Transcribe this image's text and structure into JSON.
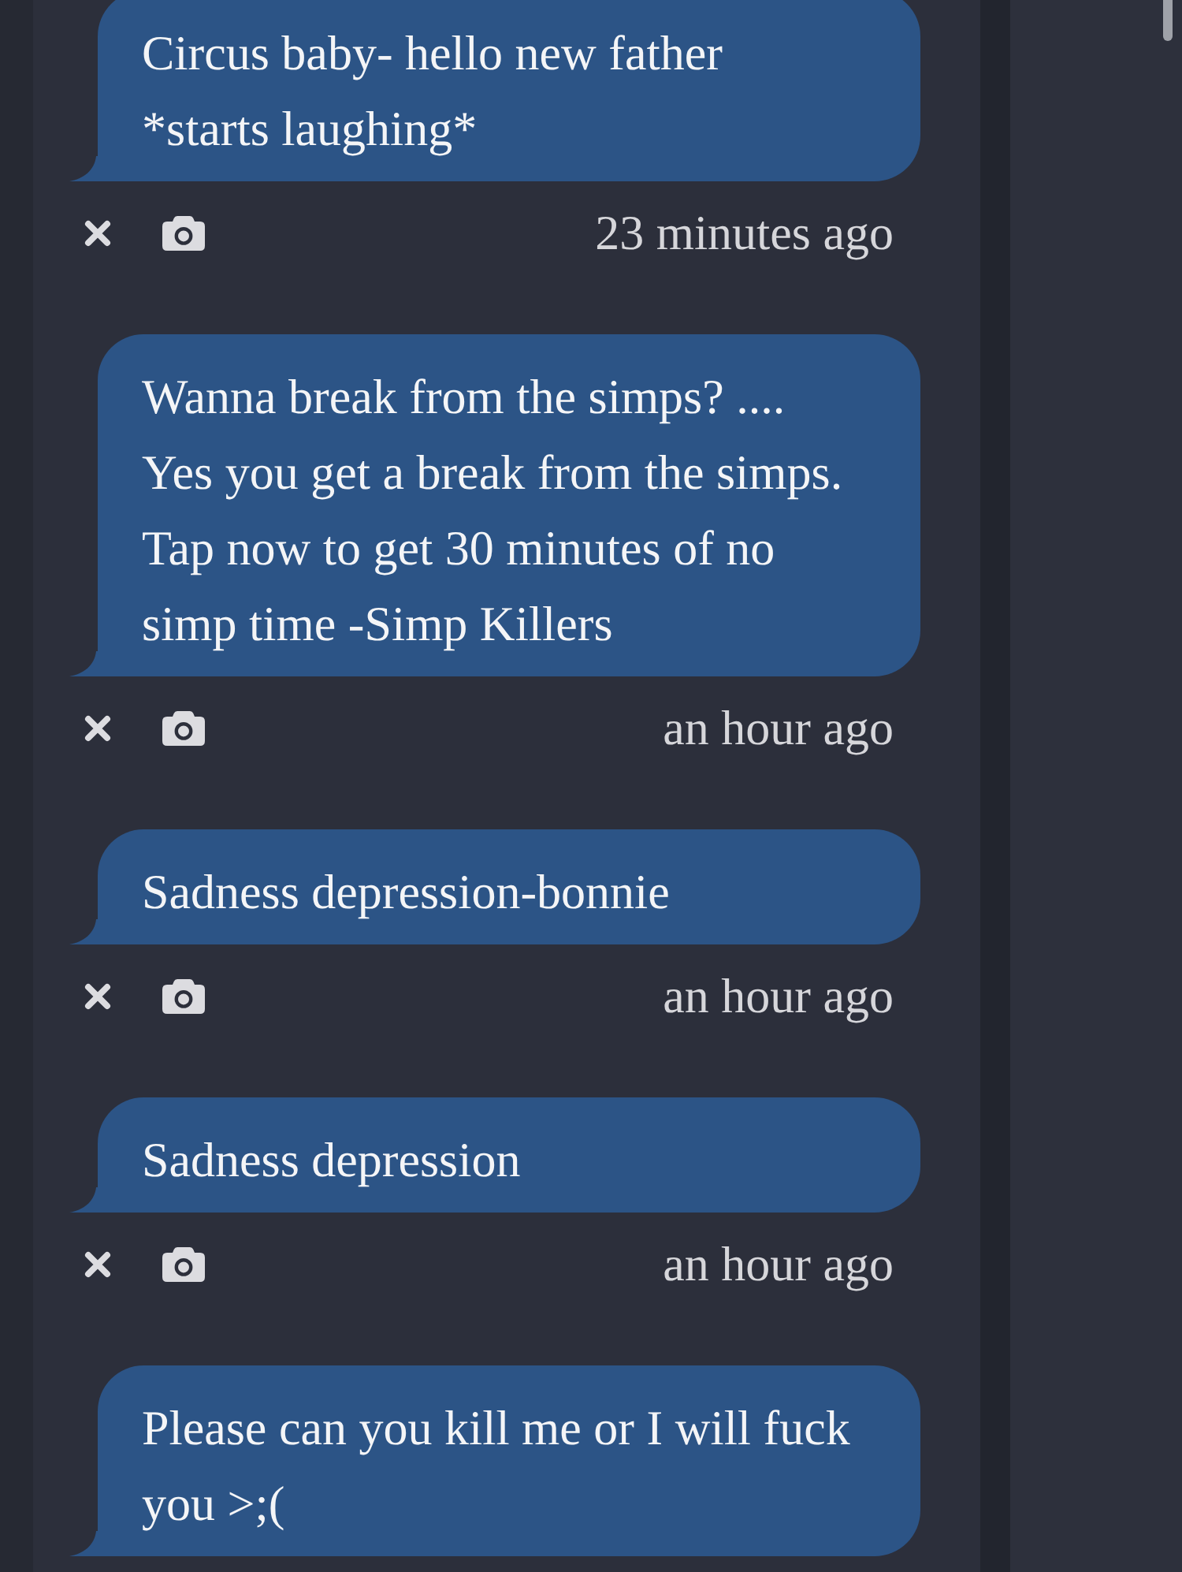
{
  "messages": [
    {
      "text": "Circus baby- hello new father *starts laughing*",
      "time": "23 minutes ago"
    },
    {
      "text": "Wanna break from the simps? .... Yes you get a break from the simps. Tap now to get 30 minutes of no simp time -Simp Killers",
      "time": "an hour ago"
    },
    {
      "text": "Sadness depression-bonnie",
      "time": "an hour ago"
    },
    {
      "text": "Sadness depression",
      "time": "an hour ago"
    },
    {
      "text": "Please can you kill me or I will fuck you >;("
    }
  ]
}
